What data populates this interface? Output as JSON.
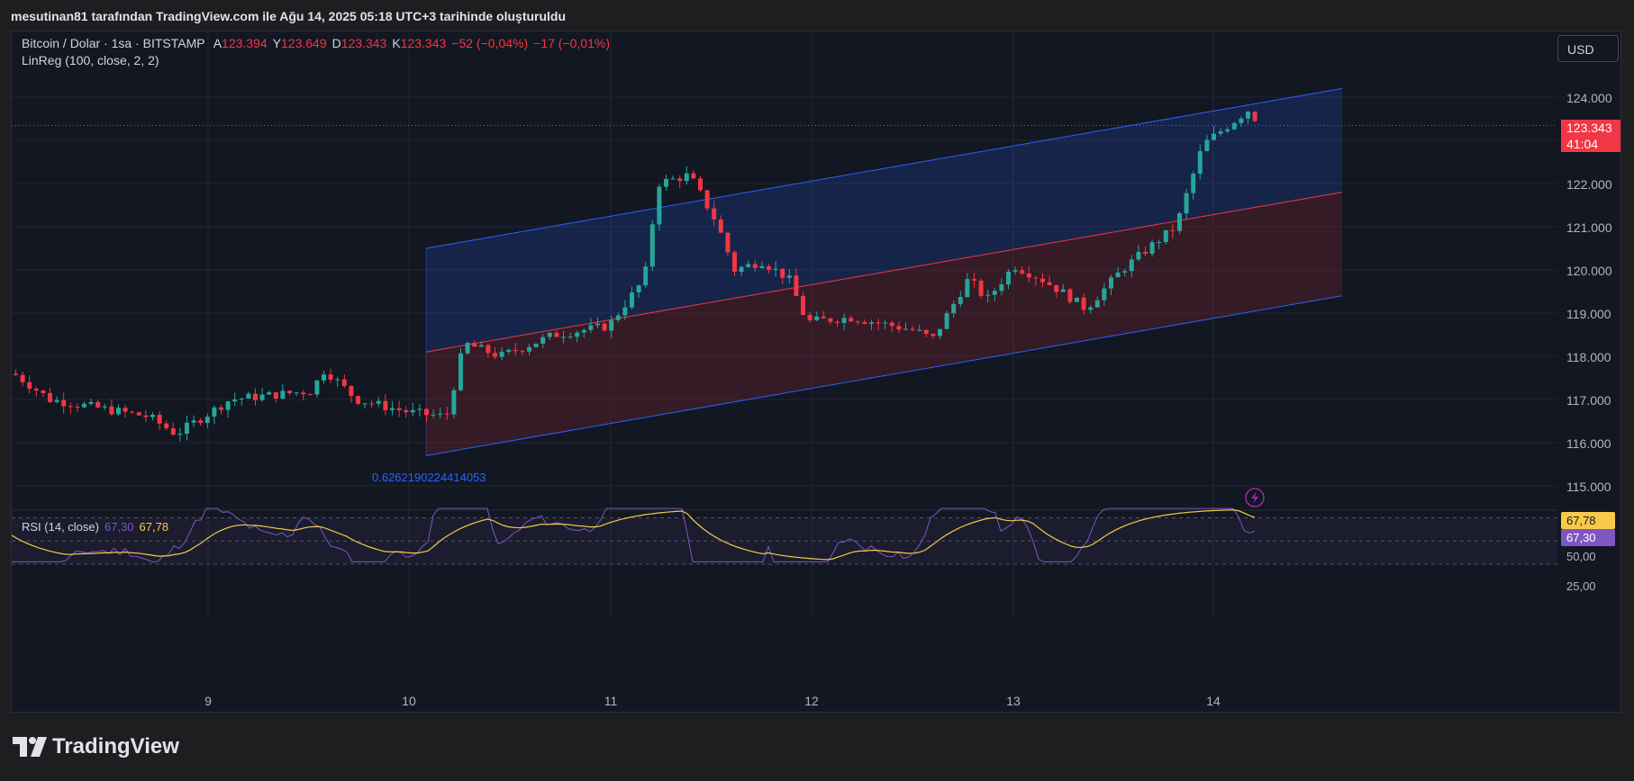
{
  "header": {
    "text": "mesutinan81 tarafından TradingView.com ile Ağu 14, 2025 05:18 UTC+3 tarihinde oluşturuldu"
  },
  "legend": {
    "symbol": "Bitcoin / Dolar · 1sa · BITSTAMP",
    "open_label": "A",
    "open": "123.394",
    "high_label": "Y",
    "high": "123.649",
    "low_label": "D",
    "low": "123.343",
    "close_label": "K",
    "close": "123.343",
    "change": "−52 (−0,04%)",
    "change2": "−17 (−0,01%)",
    "indicator": "LinReg (100, close, 2, 2)"
  },
  "currency_button": "USD",
  "price_axis": [
    "124.000",
    "122.000",
    "121.000",
    "120.000",
    "119.000",
    "118.000",
    "117.000",
    "116.000",
    "115.000"
  ],
  "current_price": {
    "value": "123.343",
    "countdown": "41:04",
    "color": "#f23645"
  },
  "linreg_label": "0.6262190224414053",
  "rsi": {
    "legend_name": "RSI (14, close)",
    "value": "67,30",
    "ma_value": "67,78",
    "axis": [
      "50,00",
      "25,00"
    ],
    "tag_value": "67,30",
    "tag_ma": "67,78",
    "line_color": "#7e57c2",
    "ma_color": "#f7c948"
  },
  "time_axis": [
    "9",
    "10",
    "11",
    "12",
    "13",
    "14"
  ],
  "colors": {
    "up": "#26a69a",
    "down": "#f23645",
    "background": "#131722",
    "channel_upper": "#2962ff",
    "channel_mid": "#f23645"
  },
  "brand": {
    "name": "TradingView"
  },
  "lightning_icon": "lightning-icon"
}
